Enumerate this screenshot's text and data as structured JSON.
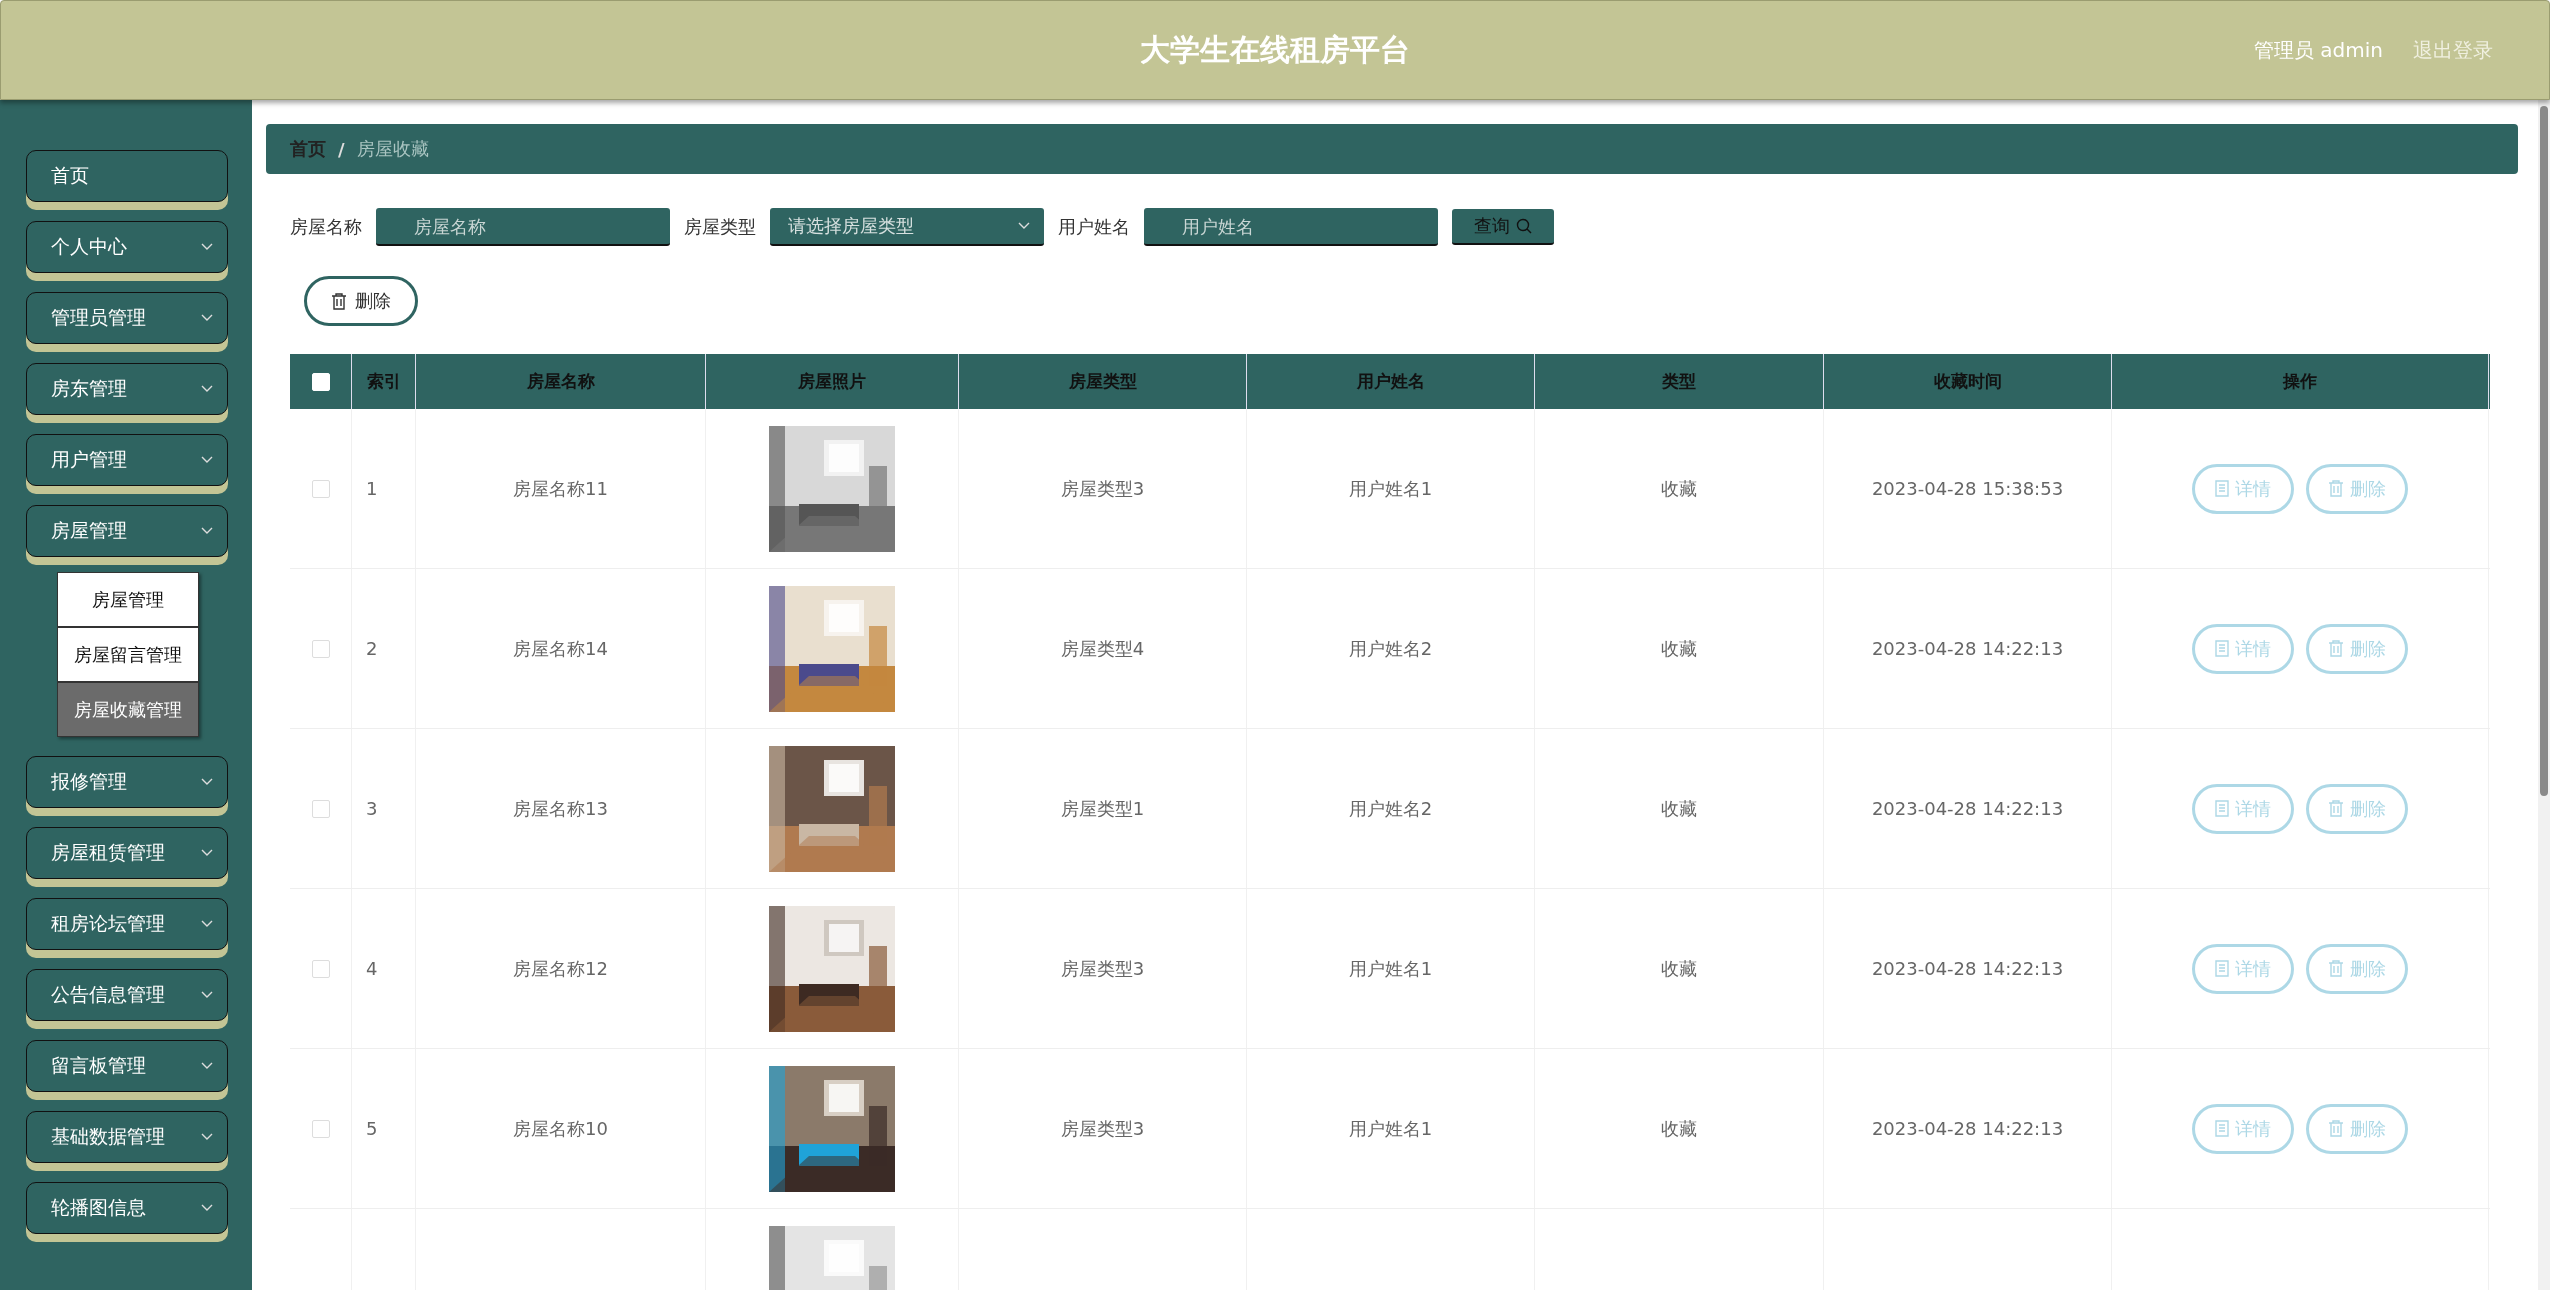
{
  "header": {
    "title": "大学生在线租房平台",
    "user": "管理员 admin",
    "logout": "退出登录"
  },
  "sidebar": {
    "items": [
      {
        "label": "首页",
        "expandable": false
      },
      {
        "label": "个人中心",
        "expandable": true
      },
      {
        "label": "管理员管理",
        "expandable": true
      },
      {
        "label": "房东管理",
        "expandable": true
      },
      {
        "label": "用户管理",
        "expandable": true
      },
      {
        "label": "房屋管理",
        "expandable": true,
        "children": [
          {
            "label": "房屋管理",
            "selected": false
          },
          {
            "label": "房屋留言管理",
            "selected": false
          },
          {
            "label": "房屋收藏管理",
            "selected": true
          }
        ]
      },
      {
        "label": "报修管理",
        "expandable": true
      },
      {
        "label": "房屋租赁管理",
        "expandable": true
      },
      {
        "label": "租房论坛管理",
        "expandable": true
      },
      {
        "label": "公告信息管理",
        "expandable": true
      },
      {
        "label": "留言板管理",
        "expandable": true
      },
      {
        "label": "基础数据管理",
        "expandable": true
      },
      {
        "label": "轮播图信息",
        "expandable": true
      }
    ]
  },
  "breadcrumb": {
    "separator": "/",
    "items": [
      "首页",
      "房屋收藏"
    ]
  },
  "filters": [
    {
      "kind": "input",
      "label": "房屋名称",
      "placeholder": "房屋名称"
    },
    {
      "kind": "select",
      "label": "房屋类型",
      "placeholder": "请选择房屋类型"
    },
    {
      "kind": "input",
      "label": "用户姓名",
      "placeholder": "用户姓名"
    }
  ],
  "search_button": "查询",
  "delete_button": "删除",
  "table": {
    "select_all_checked": false,
    "columns": [
      "索引",
      "房屋名称",
      "房屋照片",
      "房屋类型",
      "用户姓名",
      "类型",
      "收藏时间",
      "操作"
    ],
    "rows": [
      {
        "kind": "full",
        "checked": false,
        "index": "1",
        "name": "房屋名称11",
        "type": "房屋类型3",
        "user": "用户姓名1",
        "category": "收藏",
        "time": "2023-04-28 15:38:53",
        "actions": [
          "详情",
          "删除"
        ]
      },
      {
        "kind": "full",
        "checked": false,
        "index": "2",
        "name": "房屋名称14",
        "type": "房屋类型4",
        "user": "用户姓名2",
        "category": "收藏",
        "time": "2023-04-28 14:22:13",
        "actions": [
          "详情",
          "删除"
        ]
      },
      {
        "kind": "full",
        "checked": false,
        "index": "3",
        "name": "房屋名称13",
        "type": "房屋类型1",
        "user": "用户姓名2",
        "category": "收藏",
        "time": "2023-04-28 14:22:13",
        "actions": [
          "详情",
          "删除"
        ]
      },
      {
        "kind": "full",
        "checked": false,
        "index": "4",
        "name": "房屋名称12",
        "type": "房屋类型3",
        "user": "用户姓名1",
        "category": "收藏",
        "time": "2023-04-28 14:22:13",
        "actions": [
          "详情",
          "删除"
        ]
      },
      {
        "kind": "full",
        "checked": false,
        "index": "5",
        "name": "房屋名称10",
        "type": "房屋类型3",
        "user": "用户姓名1",
        "category": "收藏",
        "time": "2023-04-28 14:22:13",
        "actions": [
          "详情",
          "删除"
        ]
      },
      {
        "kind": "cut"
      }
    ]
  }
}
